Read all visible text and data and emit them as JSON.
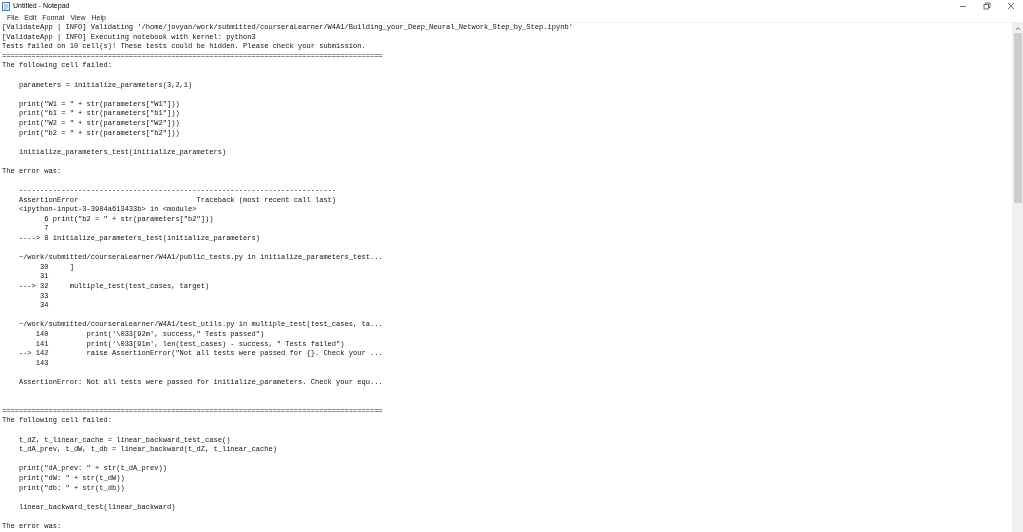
{
  "window": {
    "title": "Untitled - Notepad",
    "controls": [
      {
        "kind": "minimize"
      },
      {
        "kind": "restore"
      },
      {
        "kind": "close"
      }
    ]
  },
  "menu": [
    "File",
    "Edit",
    "Format",
    "View",
    "Help"
  ],
  "blocks": [
    {
      "kind": "plain",
      "lines": [
        "[ValidateApp | INFO] Validating '/home/jovyan/work/submitted/courseraLearner/W4A1/Building_your_Deep_Neural_Network_Step_by_Step.ipynb'",
        "[ValidateApp | INFO] Executing notebook with kernel: python3",
        "Tests failed on 10 cell(s)! These tests could be hidden. Please check your submission.",
        "==========================================================================================",
        "The following cell failed:"
      ]
    },
    {
      "kind": "spaced",
      "lines": [
        "    parameters = initialize_parameters(3,2,1)"
      ]
    },
    {
      "kind": "spaced",
      "lines": [
        "    print(\"W1 = \" + str(parameters[\"W1\"]))",
        "    print(\"b1 = \" + str(parameters[\"b1\"]))",
        "    print(\"W2 = \" + str(parameters[\"W2\"]))",
        "    print(\"b2 = \" + str(parameters[\"b2\"]))"
      ]
    },
    {
      "kind": "spaced",
      "lines": [
        "    initialize_parameters_test(initialize_parameters)"
      ]
    },
    {
      "kind": "spaced",
      "lines": [
        "The error was:"
      ]
    },
    {
      "kind": "spaced",
      "lines": [
        "    ---------------------------------------------------------------------------",
        "    AssertionError                            Traceback (most recent call last)",
        "    <ipython-input-3-3984a613433b> in <module>",
        "          6 print(\"b2 = \" + str(parameters[\"b2\"]))",
        "          7",
        "    ----> 8 initialize_parameters_test(initialize_parameters)"
      ]
    },
    {
      "kind": "spaced",
      "lines": [
        "    ~/work/submitted/courseraLearner/W4A1/public_tests.py in initialize_parameters_test...",
        "         30     ]",
        "         31",
        "    ---> 32     multiple_test(test_cases, target)",
        "         33",
        "         34"
      ]
    },
    {
      "kind": "spaced",
      "lines": [
        "    ~/work/submitted/courseraLearner/W4A1/test_utils.py in multiple_test(test_cases, ta...",
        "        140         print('\\033[92m', success,\" Tests passed\")",
        "        141         print('\\033[91m', len(test_cases) - success, \" Tests failed\")",
        "    --> 142         raise AssertionError(\"Not all tests were passed for {}. Check your ...",
        "        143"
      ]
    },
    {
      "kind": "spaced",
      "lines": [
        "    AssertionError: Not all tests were passed for initialize_parameters. Check your equ..."
      ]
    },
    {
      "kind": "wide",
      "lines": [
        "==========================================================================================",
        "The following cell failed:"
      ]
    },
    {
      "kind": "spaced",
      "lines": [
        "    t_dZ, t_linear_cache = linear_backward_test_case()",
        "    t_dA_prev, t_dW, t_db = linear_backward(t_dZ, t_linear_cache)"
      ]
    },
    {
      "kind": "spaced",
      "lines": [
        "    print(\"dA_prev: \" + str(t_dA_prev))",
        "    print(\"dW: \" + str(t_dW))",
        "    print(\"db: \" + str(t_db))"
      ]
    },
    {
      "kind": "spaced",
      "lines": [
        "    linear_backward_test(linear_backward)"
      ]
    },
    {
      "kind": "spaced",
      "lines": [
        "The error was:"
      ]
    }
  ]
}
